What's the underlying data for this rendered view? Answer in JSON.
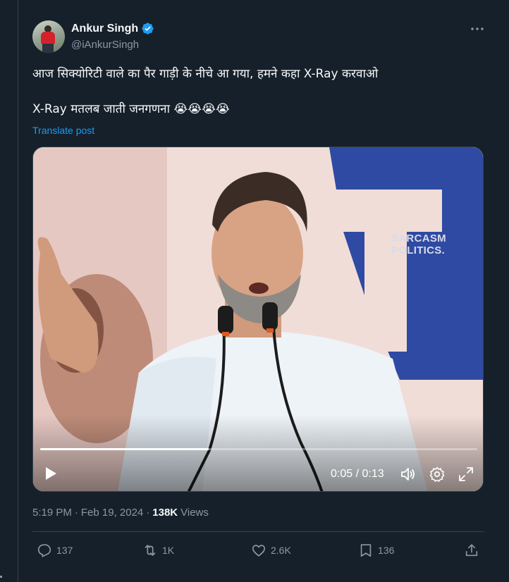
{
  "author": {
    "display_name": "Ankur Singh",
    "handle": "@iAnkurSingh",
    "verified": true,
    "verified_color": "#1d9bf0"
  },
  "tweet": {
    "text": "आज सिक्योरिटी वाले का पैर गाड़ी के नीचे आ गया, हमने कहा X-Ray करवाओ\n\nX-Ray मतलब जाती जनगणना 😭😭😭😭",
    "translate_label": "Translate post"
  },
  "video": {
    "watermark": "SARCASM\nPOLITICS.",
    "elapsed": "0:05",
    "duration": "0:13",
    "time_display": "0:05 / 0:13",
    "progress_fraction": 0.385
  },
  "meta": {
    "time": "5:19 PM",
    "separator": "·",
    "date": "Feb 19, 2024",
    "views_count": "138K",
    "views_label": "Views"
  },
  "actions": {
    "replies": "137",
    "reposts": "1K",
    "likes": "2.6K",
    "bookmarks": "136"
  },
  "icons": {
    "more": "more-icon",
    "reply": "reply-icon",
    "repost": "repost-icon",
    "like": "heart-icon",
    "bookmark": "bookmark-icon",
    "share": "share-icon",
    "play": "play-icon",
    "volume": "volume-icon",
    "settings": "gear-icon",
    "fullscreen": "fullscreen-icon"
  },
  "colors": {
    "background": "#15202b",
    "text_primary": "#f7f9f9",
    "text_secondary": "#8b98a5",
    "accent": "#1d9bf0",
    "border": "#38444d"
  }
}
